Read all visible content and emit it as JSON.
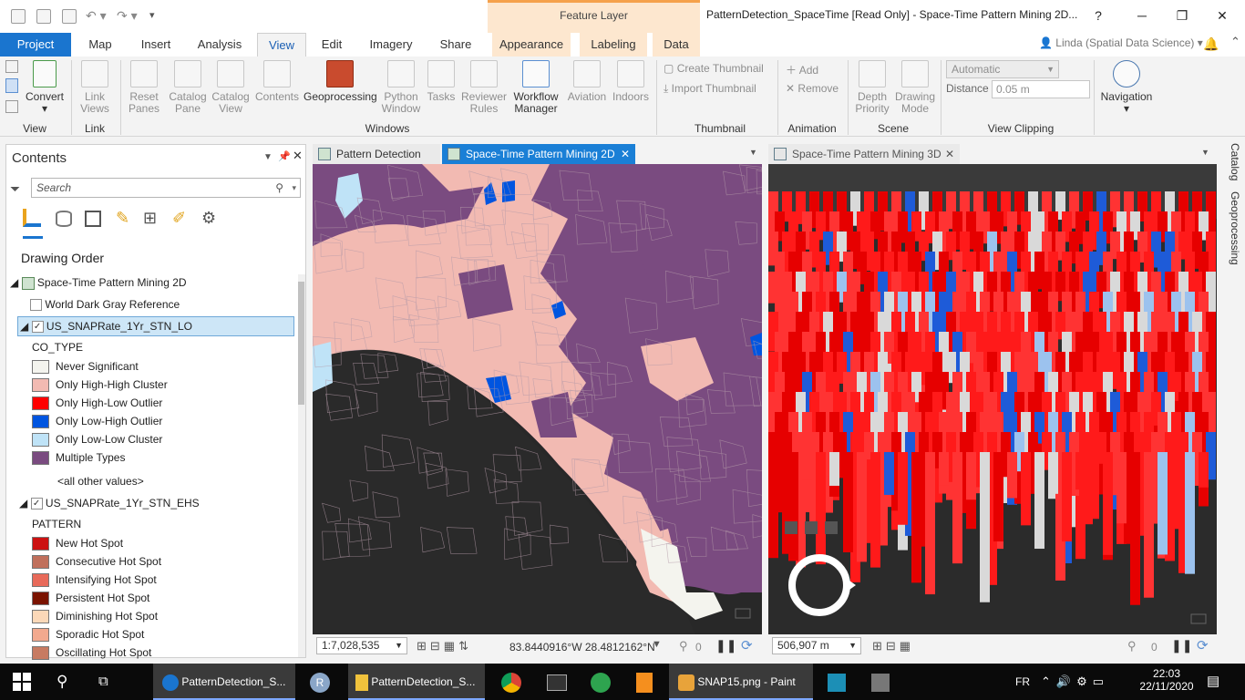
{
  "window": {
    "title": "PatternDetection_SpaceTime [Read Only] - Space-Time Pattern Mining 2D...",
    "contextual_label": "Feature Layer",
    "help": "?",
    "minimize": "─",
    "restore": "❐",
    "close": "✕",
    "user": "Linda (Spatial Data Science)"
  },
  "tabs": [
    "Project",
    "Map",
    "Insert",
    "Analysis",
    "View",
    "Edit",
    "Imagery",
    "Share",
    "Appearance",
    "Labeling",
    "Data"
  ],
  "ribbon": {
    "view": {
      "convert": "Convert",
      "group": "View"
    },
    "link": {
      "link_views": "Link Views",
      "group": "Link"
    },
    "windows": {
      "reset_panes": "Reset Panes",
      "catalog_pane": "Catalog Pane",
      "catalog_view": "Catalog View",
      "contents": "Contents",
      "geoprocessing": "Geoprocessing",
      "python_window": "Python Window",
      "tasks": "Tasks",
      "reviewer_rules": "Reviewer Rules",
      "workflow_manager": "Workflow Manager",
      "aviation": "Aviation",
      "indoors": "Indoors",
      "group": "Windows"
    },
    "thumbnail": {
      "create": "Create Thumbnail",
      "import": "Import Thumbnail",
      "group": "Thumbnail"
    },
    "animation": {
      "add": "Add",
      "remove": "Remove",
      "group": "Animation"
    },
    "scene": {
      "depth_priority": "Depth Priority",
      "drawing_mode": "Drawing Mode",
      "group": "Scene"
    },
    "clipping": {
      "mode": "Automatic",
      "distance_label": "Distance",
      "distance_value": "0.05",
      "distance_unit": "m",
      "group": "View Clipping"
    },
    "navigation": {
      "label": "Navigation"
    }
  },
  "contents": {
    "title": "Contents",
    "search_placeholder": "Search",
    "drawing_order": "Drawing Order",
    "map_name": "Space-Time Pattern Mining 2D",
    "basemap": "World Dark Gray Reference",
    "layer1": {
      "name": "US_SNAPRate_1Yr_STN_LO",
      "field": "CO_TYPE",
      "classes": [
        {
          "label": "Never Significant",
          "color": "#f4f4ee"
        },
        {
          "label": "Only High-High Cluster",
          "color": "#f2bab2"
        },
        {
          "label": "Only High-Low Outlier",
          "color": "#ff0000"
        },
        {
          "label": "Only Low-High Outlier",
          "color": "#0055e0"
        },
        {
          "label": "Only Low-Low Cluster",
          "color": "#bfe3f7"
        },
        {
          "label": "Multiple Types",
          "color": "#7a4b80"
        }
      ],
      "other": "<all other values>"
    },
    "layer2": {
      "name": "US_SNAPRate_1Yr_STN_EHS",
      "field": "PATTERN",
      "classes": [
        {
          "label": "New Hot Spot",
          "color": "#cc1111"
        },
        {
          "label": "Consecutive Hot Spot",
          "color": "#c0705c"
        },
        {
          "label": "Intensifying Hot Spot",
          "color": "#e86a5a"
        },
        {
          "label": "Persistent Hot Spot",
          "color": "#7a1300"
        },
        {
          "label": "Diminishing Hot Spot",
          "color": "#fbd8b8"
        },
        {
          "label": "Sporadic Hot Spot",
          "color": "#f2a98e"
        },
        {
          "label": "Oscillating Hot Spot",
          "color": "#c77b62"
        }
      ]
    }
  },
  "views": {
    "tab1": "Pattern Detection",
    "tab2": "Space-Time Pattern Mining 2D",
    "tab3": "Space-Time Pattern Mining 3D"
  },
  "status2d": {
    "scale": "1:7,028,535",
    "coords": "83.8440916°W 28.4812162°N",
    "count": "0"
  },
  "status3d": {
    "scale": "506,907 m",
    "count": "0"
  },
  "right_tabs": [
    "Catalog",
    "Geoprocessing"
  ],
  "taskbar": {
    "apps": [
      "PatternDetection_S...",
      "PatternDetection_S...",
      "SNAP15.png - Paint"
    ],
    "lang": "FR",
    "time": "22:03",
    "date": "22/11/2020"
  },
  "colors": {
    "project_blue": "#1a75cf",
    "contextual": "#fde7cf",
    "active_tab": "#1a7fd6"
  }
}
